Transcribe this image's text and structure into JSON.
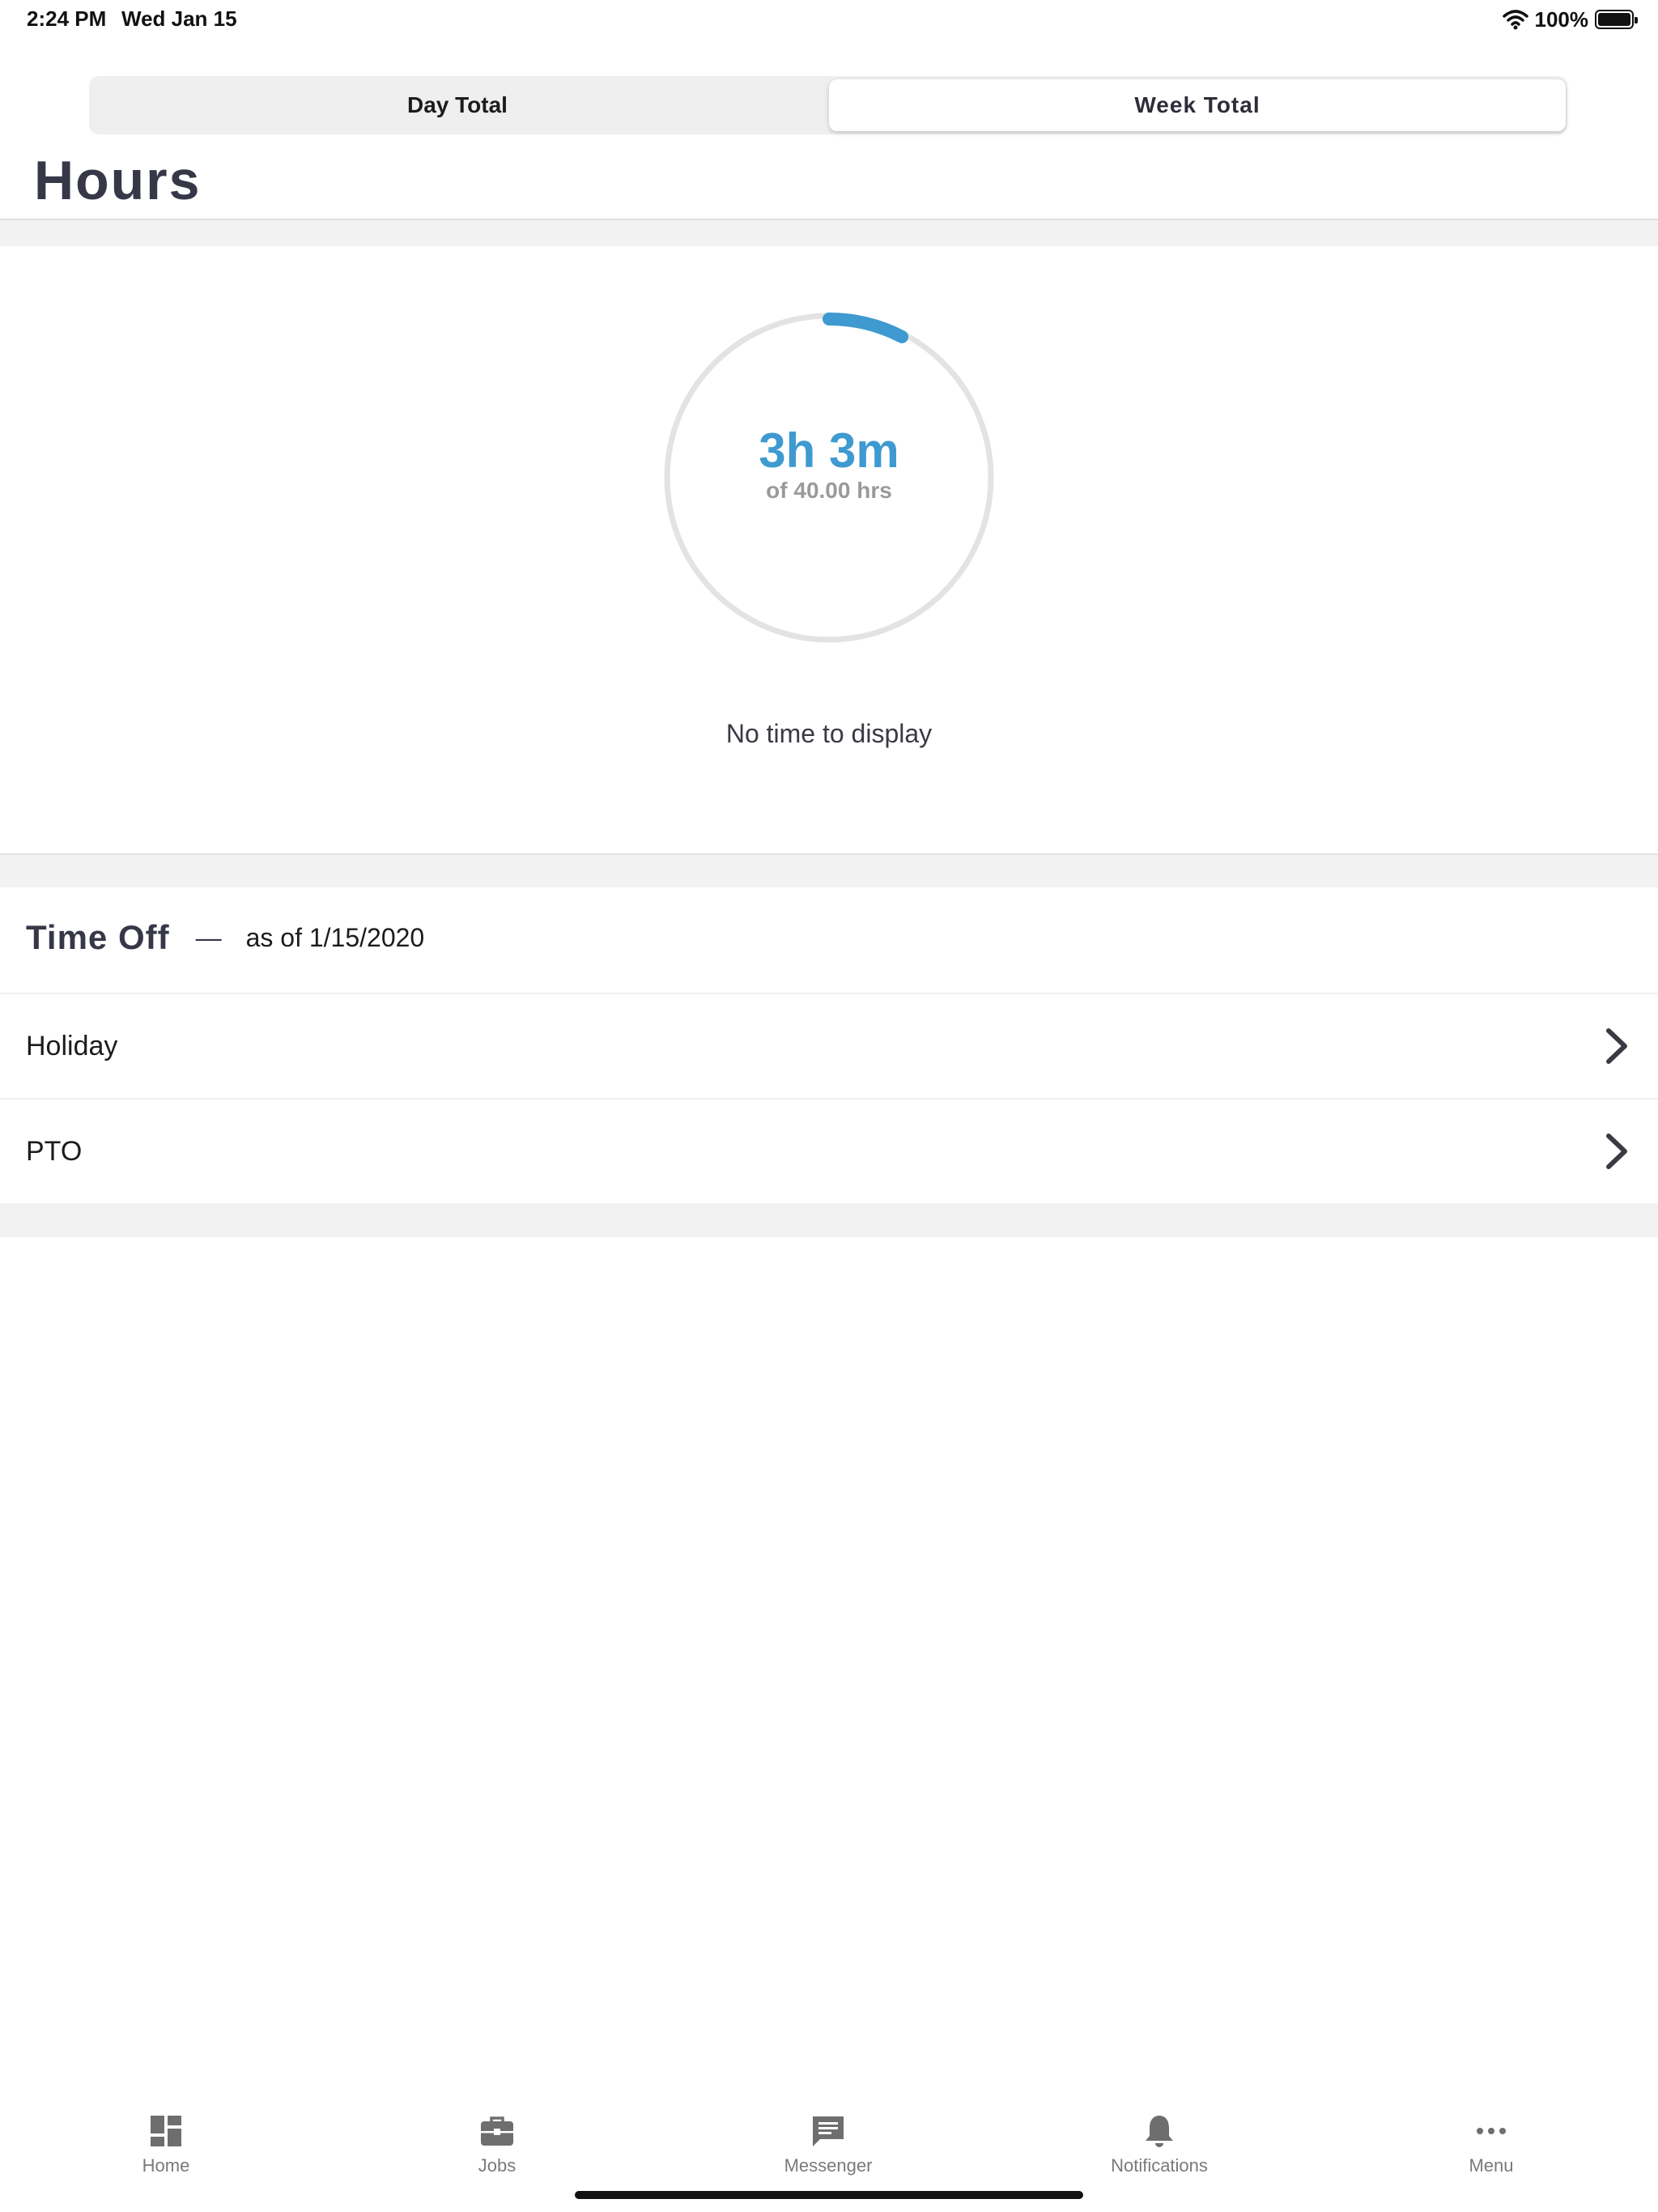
{
  "status_bar": {
    "time": "2:24 PM",
    "date": "Wed Jan 15",
    "battery": "100%",
    "icons": [
      "wifi-icon",
      "battery-icon"
    ]
  },
  "segmented": {
    "day_label": "Day Total",
    "week_label": "Week Total",
    "selected": "Week Total"
  },
  "page": {
    "title": "Hours"
  },
  "hours_ring": {
    "value_label": "3h 3m",
    "goal_label": "of 40.00 hrs",
    "progress_fraction": 0.076,
    "colors": {
      "track": "#e3e3e3",
      "progress": "#3e9ad0"
    }
  },
  "empty_message": "No time to display",
  "time_off": {
    "title": "Time Off",
    "dash": "—",
    "as_of": "as of 1/15/2020",
    "items": [
      {
        "label": "Holiday",
        "icon": "chevron-right-icon"
      },
      {
        "label": "PTO",
        "icon": "chevron-right-icon"
      }
    ]
  },
  "tab_bar": {
    "tabs": [
      {
        "label": "Home",
        "icon": "home-icon"
      },
      {
        "label": "Jobs",
        "icon": "briefcase-icon"
      },
      {
        "label": "Messenger",
        "icon": "chat-icon"
      },
      {
        "label": "Notifications",
        "icon": "bell-icon"
      },
      {
        "label": "Menu",
        "icon": "more-icon"
      }
    ]
  }
}
